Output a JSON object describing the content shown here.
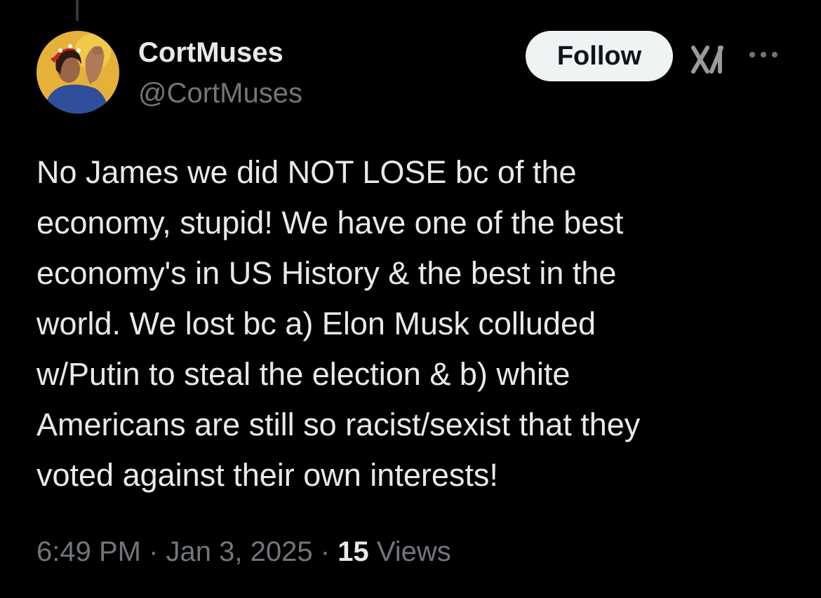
{
  "author": {
    "display_name": "CortMuses",
    "handle": "@CortMuses"
  },
  "actions": {
    "follow_label": "Follow"
  },
  "tweet": {
    "lines": [
      "No James we did NOT LOSE bc of the",
      "economy, stupid! We have one of the best",
      "economy's in US History & the best in the",
      "world. We lost bc a) Elon Musk colluded",
      "w/Putin to steal the election & b) white",
      "Americans are still so racist/sexist that they",
      "voted against their own interests!"
    ]
  },
  "meta": {
    "time": "6:49 PM",
    "separator": "·",
    "date": "Jan 3, 2025",
    "views_count": "15",
    "views_label": "Views"
  },
  "icons": {
    "grok": "grok-icon",
    "more": "more-icon"
  },
  "colors": {
    "background": "#000000",
    "primary_text": "#e7e9ea",
    "secondary_text": "#71767b",
    "follow_bg": "#eff3f4",
    "follow_text": "#0f1419"
  }
}
